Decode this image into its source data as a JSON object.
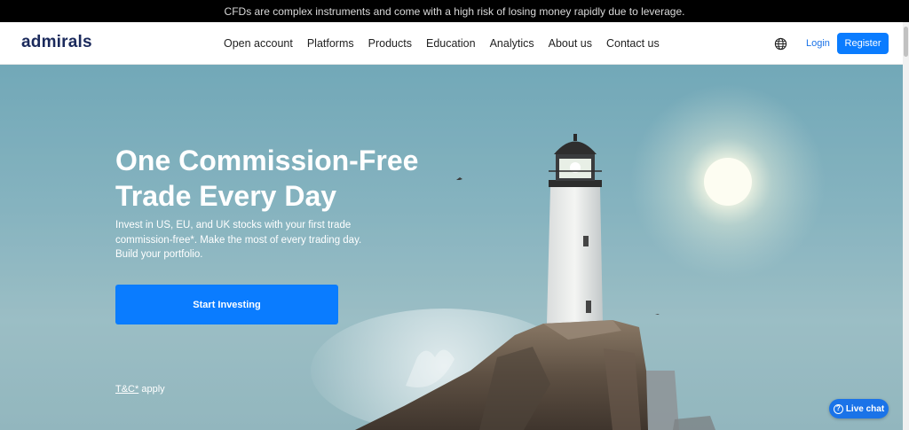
{
  "risk_warning": "CFDs are complex instruments and come with a high risk of losing money rapidly due to leverage.",
  "header": {
    "logo": "admirals",
    "menu": [
      "Open account",
      "Platforms",
      "Products",
      "Education",
      "Analytics",
      "About us",
      "Contact us"
    ],
    "language_icon": "globe-icon",
    "login_label": "Login",
    "register_label": "Register"
  },
  "hero": {
    "title_line1": "One Commission-Free",
    "title_line2": "Trade Every Day",
    "subtitle_line1": "Invest in US, EU, and UK stocks with your first trade",
    "subtitle_line2": "commission-free*. Make the most of every trading day.",
    "subtitle_line3": "Build your portfolio.",
    "cta_label": "Start Investing",
    "tc_link": "T&C*",
    "tc_suffix": " apply"
  },
  "livechat": {
    "label": "Live chat",
    "icon": "question-icon"
  },
  "colors": {
    "accent": "#0a7cff",
    "logo": "#1b2a5c",
    "risk_bar": "#000000"
  }
}
